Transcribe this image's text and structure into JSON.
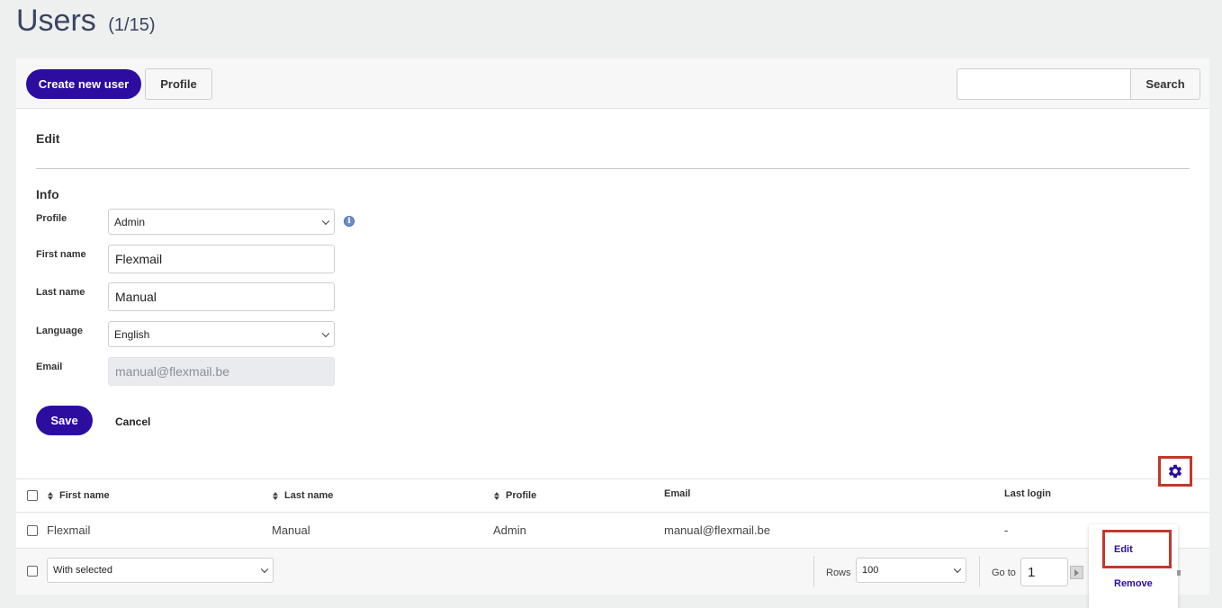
{
  "page": {
    "title": "Users",
    "count": "(1/15)"
  },
  "toolbar": {
    "create_label": "Create new user",
    "profile_label": "Profile",
    "search_value": "",
    "search_label": "Search"
  },
  "edit": {
    "title": "Edit",
    "section_title": "Info",
    "fields": {
      "profile": {
        "label": "Profile",
        "value": "Admin"
      },
      "first_name": {
        "label": "First name",
        "value": "Flexmail"
      },
      "last_name": {
        "label": "Last name",
        "value": "Manual"
      },
      "language": {
        "label": "Language",
        "value": "English"
      },
      "email": {
        "label": "Email",
        "value": "manual@flexmail.be"
      }
    },
    "save_label": "Save",
    "cancel_label": "Cancel"
  },
  "table": {
    "headers": {
      "first_name": "First name",
      "last_name": "Last name",
      "profile": "Profile",
      "email": "Email",
      "last_login": "Last login"
    },
    "rows": [
      {
        "first_name": "Flexmail",
        "last_name": "Manual",
        "profile": "Admin",
        "email": "manual@flexmail.be",
        "last_login": "-"
      }
    ]
  },
  "footer": {
    "with_selected": "With selected",
    "rows_label": "Rows",
    "rows_value": "100",
    "goto_label": "Go to",
    "goto_value": "1"
  },
  "row_menu": {
    "edit_label": "Edit",
    "remove_label": "Remove"
  },
  "colors": {
    "primary": "#2c0da0",
    "highlight": "#c0392b",
    "background": "#eef0f0"
  }
}
